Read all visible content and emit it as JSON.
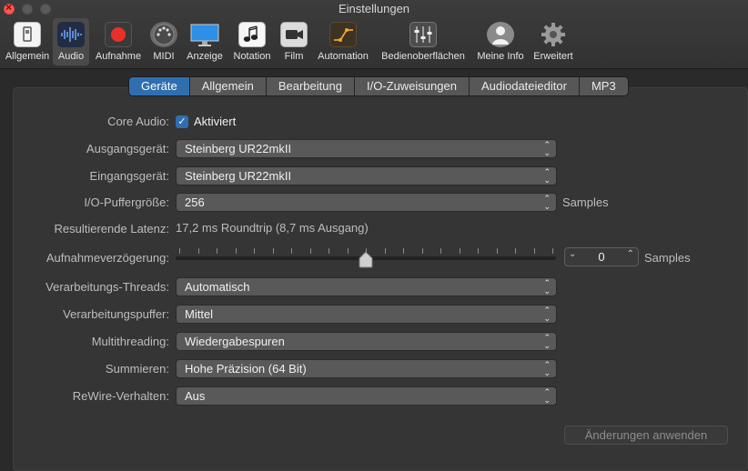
{
  "window": {
    "title": "Einstellungen"
  },
  "toolbar": [
    {
      "label": "Allgemein",
      "icon": "switch-icon"
    },
    {
      "label": "Audio",
      "icon": "waveform-icon"
    },
    {
      "label": "Aufnahme",
      "icon": "record-icon"
    },
    {
      "label": "MIDI",
      "icon": "midi-port-icon"
    },
    {
      "label": "Anzeige",
      "icon": "monitor-icon"
    },
    {
      "label": "Notation",
      "icon": "notation-icon"
    },
    {
      "label": "Film",
      "icon": "film-camera-icon"
    },
    {
      "label": "Automation",
      "icon": "automation-icon"
    },
    {
      "label": "Bedienoberflächen",
      "icon": "faders-icon"
    },
    {
      "label": "Meine Info",
      "icon": "user-icon"
    },
    {
      "label": "Erweitert",
      "icon": "gear-icon"
    }
  ],
  "tabs": [
    "Geräte",
    "Allgemein",
    "Bearbeitung",
    "I/O-Zuweisungen",
    "Audiodateieditor",
    "MP3"
  ],
  "form": {
    "core_audio": {
      "label": "Core Audio:",
      "checkbox_label": "Aktiviert",
      "checked": true
    },
    "output_device": {
      "label": "Ausgangsgerät:",
      "value": "Steinberg UR22mkII"
    },
    "input_device": {
      "label": "Eingangsgerät:",
      "value": "Steinberg UR22mkII"
    },
    "io_buffer": {
      "label": "I/O-Puffergröße:",
      "value": "256",
      "unit": "Samples"
    },
    "latency": {
      "label": "Resultierende Latenz:",
      "value": "17,2 ms Roundtrip (8,7 ms Ausgang)"
    },
    "record_delay": {
      "label": "Aufnahmeverzögerung:",
      "value": "0",
      "unit": "Samples",
      "slider_position": 0.5
    },
    "threads": {
      "label": "Verarbeitungs-Threads:",
      "value": "Automatisch"
    },
    "process_buffer": {
      "label": "Verarbeitungspuffer:",
      "value": "Mittel"
    },
    "multithreading": {
      "label": "Multithreading:",
      "value": "Wiedergabespuren"
    },
    "summing": {
      "label": "Summieren:",
      "value": "Hohe Präzision (64 Bit)"
    },
    "rewire": {
      "label": "ReWire-Verhalten:",
      "value": "Aus"
    }
  },
  "apply_button": {
    "label": "Änderungen anwenden",
    "enabled": false
  },
  "colors": {
    "accent": "#2f6fb0",
    "background": "#353535",
    "record_red": "#e8302b"
  }
}
